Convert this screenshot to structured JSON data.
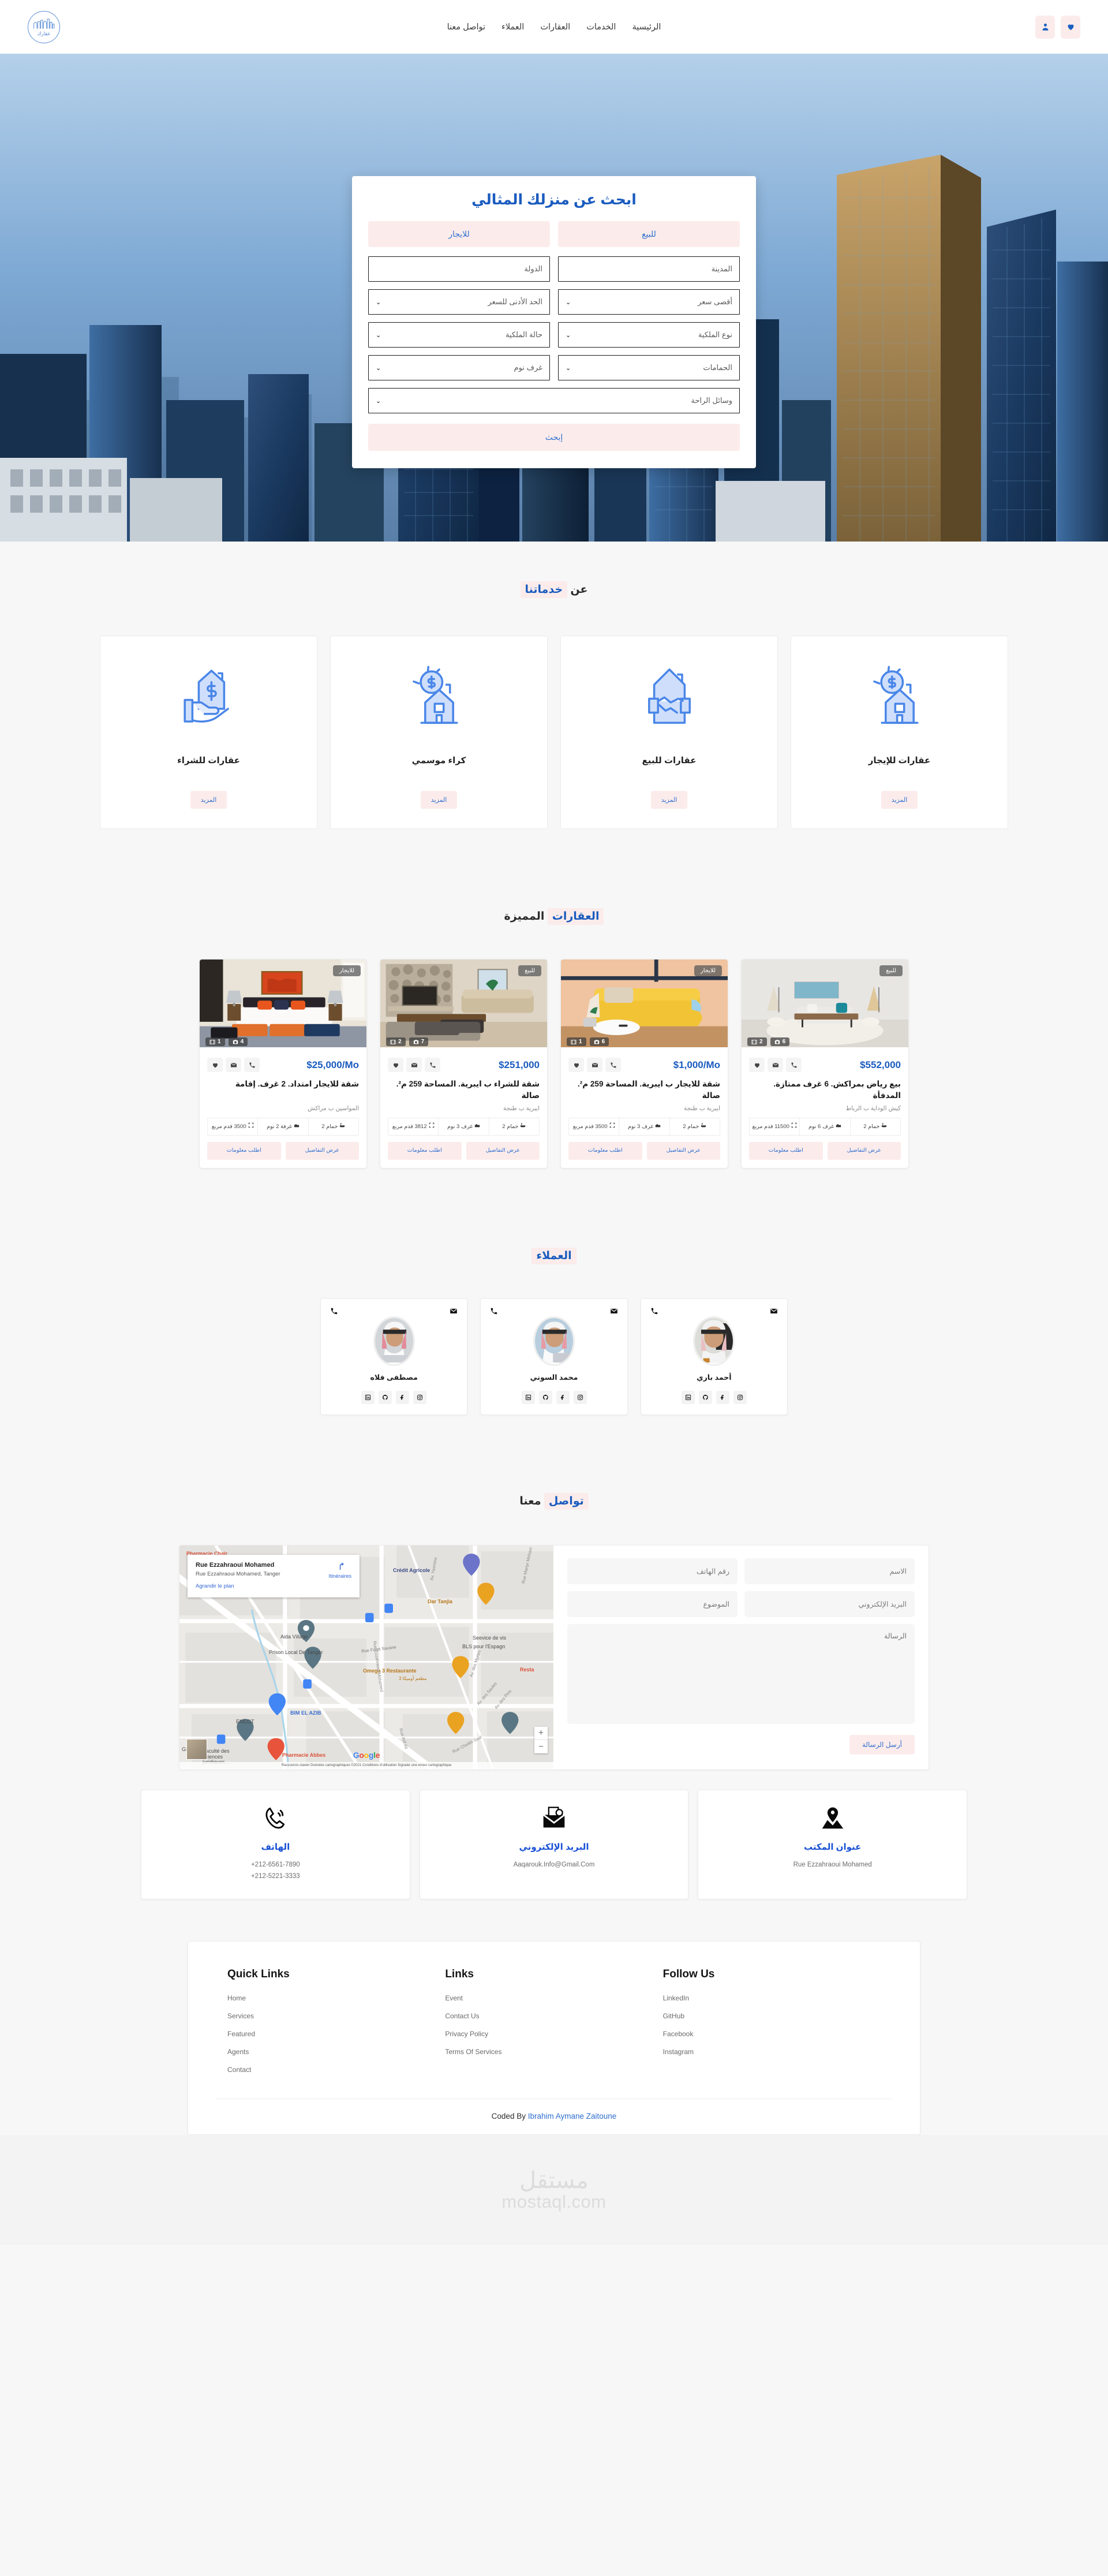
{
  "header": {
    "logo_word": "عقارك",
    "nav": [
      {
        "label": "الرئيسية"
      },
      {
        "label": "الخدمات"
      },
      {
        "label": "العقارات"
      },
      {
        "label": "العملاء"
      },
      {
        "label": "تواصل معنا"
      }
    ],
    "actions": [
      {
        "name": "favorites",
        "icon": "heart-icon"
      },
      {
        "name": "account",
        "icon": "user-icon"
      }
    ]
  },
  "hero": {
    "form_title": "ابحث عن منزلك المثالي",
    "tab_sale": "للبيع",
    "tab_rent": "للايجار",
    "city_placeholder": "المدينة",
    "country_placeholder": "الدولة",
    "max_price": "أقصى سعر",
    "min_price": "الحد الأدنى للسعر",
    "property_type": "نوع الملكية",
    "property_status": "حالة الملكية",
    "bathrooms": "الحمامات",
    "bedrooms": "غرف نوم",
    "amenities": "وسائل الراحة",
    "search_button": "إبحث"
  },
  "services": {
    "title_plain": "عن",
    "title_highlight": "خدماتنا",
    "more_label": "المزيد",
    "items": [
      {
        "name": "عقارات للشراء",
        "icon": "house-in-hand-icon"
      },
      {
        "name": "عقارات للإيجار",
        "icon": "house-dollar-icon"
      },
      {
        "name": "عقارات للبيع",
        "icon": "handshake-house-icon"
      },
      {
        "name": "كراء موسمي",
        "icon": "house-coin-icon"
      }
    ]
  },
  "featured": {
    "title_highlight": "العقارات",
    "title_plain": "المميزة",
    "btn_request": "اطلب معلومات",
    "btn_details": "عرض التفاصيل",
    "properties": [
      {
        "badge": "للايجار",
        "videos": "1",
        "photos": "4",
        "price": "$25,000/Mo",
        "title": "شقة للايجار امتداد. 2 غرف. إقامة",
        "location": "المواسين ب مراكش",
        "area": "3500 قدم مربع",
        "beds": "غرفة 2 نوم",
        "baths": "حمام 2",
        "img": "bedroom"
      },
      {
        "badge": "للبيع",
        "videos": "2",
        "photos": "7",
        "price": "$251,000",
        "title": "شقة للشراء ب ايبرية. المساحة 259 م². صالة",
        "location": "ايبرية ب طنجة",
        "area": "3812 قدم مربع",
        "beds": "غرف 3 نوم",
        "baths": "حمام 2",
        "img": "fireplace"
      },
      {
        "badge": "للايجار",
        "videos": "1",
        "photos": "6",
        "price": "$1,000/Mo",
        "title": "شقة للايجار ب ايبرية. المساحة 259 م². صالة",
        "location": "ايبرية ب طنجة",
        "area": "3500 قدم مربع",
        "beds": "غرف 3 نوم",
        "baths": "حمام 2",
        "img": "yellow-sofa"
      },
      {
        "badge": "للبيع",
        "videos": "2",
        "photos": "6",
        "price": "$552,000",
        "title": "بيع رياض بمراكش. 6 غرف ممتازة. المدفأة",
        "location": "كيش الوداية ب الرباط",
        "area": "11500 قدم مربع",
        "beds": "غرف 6 نوم",
        "baths": "حمام 2",
        "img": "living-room"
      }
    ]
  },
  "agents": {
    "title": "العملاء",
    "items": [
      {
        "name": "أحمد باري"
      },
      {
        "name": "محمد السوني"
      },
      {
        "name": "مصطفى فلاه"
      }
    ],
    "socials": [
      "linkedin-icon",
      "github-icon",
      "facebook-icon",
      "instagram-icon"
    ]
  },
  "contact": {
    "title_highlight": "تواصل",
    "title_plain": "معنا",
    "name_placeholder": "الاسم",
    "phone_placeholder": "رقم الهاتف",
    "email_placeholder": "البريد الإلكتروني",
    "subject_placeholder": "الموضوع",
    "message_placeholder": "الرسالة",
    "send_button": "أرسل الرسالة",
    "map": {
      "card_title": "Rue Ezzahraoui Mohamed",
      "card_subtitle": "Rue Ezzahraoui Mohamed, Tanger",
      "expand_label": "Agrandir le plan",
      "directions_label": "Itinéraires",
      "brand": "Google",
      "attribution": "Raccourcis clavier   Données cartographiques ©2021   Conditions d'utilisation   Signaler une erreur cartographique",
      "zoom_in": "+",
      "zoom_out": "−",
      "labels": [
        "Pharmacie Chair",
        "Crédit Agricole",
        "Dar Tanjia",
        "Aida Village",
        "Prison Local De Tanger",
        "Rue Foret Savane",
        "Omega 3 Restaurante",
        "مطعم أوميكا 3",
        "Seevice de vis",
        "BLS pour l'Espagn",
        "Resta",
        "BIM EL AZIB",
        "ENCGT",
        "Faculté des sciences juridiques,...",
        "Pharmacie Abbes",
        "Av. Yasmine",
        "Rue Martyr Moham",
        "Av. des Myrtes",
        "Av. des Saules",
        "Av. des Pins",
        "Rue Ezzahraoui Mohamed",
        "Rue Arif Ali",
        "Rue Cheikh Said",
        "GER"
      ]
    },
    "info": [
      {
        "title": "الهاتف",
        "icon": "phone-icon",
        "lines": [
          "+212-6561-7890",
          "+212-5221-3333"
        ]
      },
      {
        "title": "البريد الإلكتروني",
        "icon": "email-icon",
        "lines": [
          "Aaqarouk.Info@Gmail.Com"
        ]
      },
      {
        "title": "عنوان المكتب",
        "icon": "map-pin-icon",
        "lines": [
          "Rue Ezzahraoui Mohamed"
        ]
      }
    ]
  },
  "footer": {
    "columns": [
      {
        "heading": "Quick Links",
        "links": [
          "Home",
          "Services",
          "Featured",
          "Agents",
          "Contact"
        ]
      },
      {
        "heading": "Links",
        "links": [
          "Event",
          "Contact Us",
          "Privacy Policy",
          "Terms Of Services"
        ]
      },
      {
        "heading": "Follow Us",
        "links": [
          "LinkedIn",
          "GitHub",
          "Facebook",
          "Instagram"
        ]
      }
    ],
    "credit_prefix": "Coded By ",
    "credit_name": "Ibrahim Aymane Zaitoune"
  },
  "watermark": {
    "arabic": "مستقل",
    "latin": "mostaql.com"
  }
}
